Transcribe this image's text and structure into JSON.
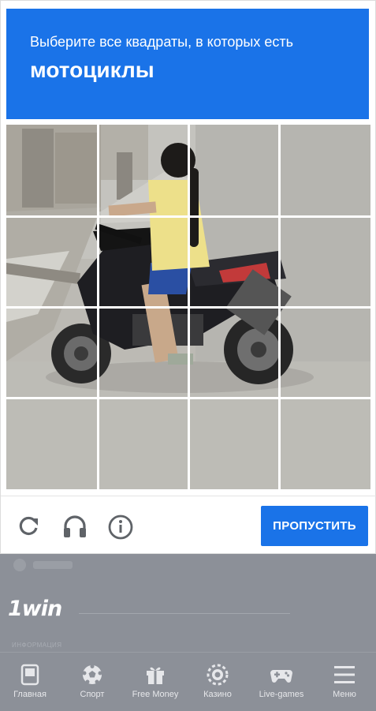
{
  "captcha": {
    "prompt_line1": "Выберите все квадраты, в которых есть",
    "prompt_line2": "мотоциклы",
    "skip_label": "ПРОПУСТИТЬ",
    "accent_color": "#1a73e8",
    "grid_rows": 4,
    "grid_cols": 4,
    "icons": [
      "refresh-icon",
      "headphones-icon",
      "info-icon"
    ]
  },
  "background_page": {
    "logo": "1win",
    "info_label": "информация",
    "bottom_nav": [
      {
        "label": "Главная",
        "icon": "home-icon"
      },
      {
        "label": "Спорт",
        "icon": "soccer-ball-icon"
      },
      {
        "label": "Free Money",
        "icon": "gift-icon"
      },
      {
        "label": "Казино",
        "icon": "casino-chip-icon"
      },
      {
        "label": "Live-games",
        "icon": "gamepad-icon"
      },
      {
        "label": "Меню",
        "icon": "menu-icon"
      }
    ]
  }
}
